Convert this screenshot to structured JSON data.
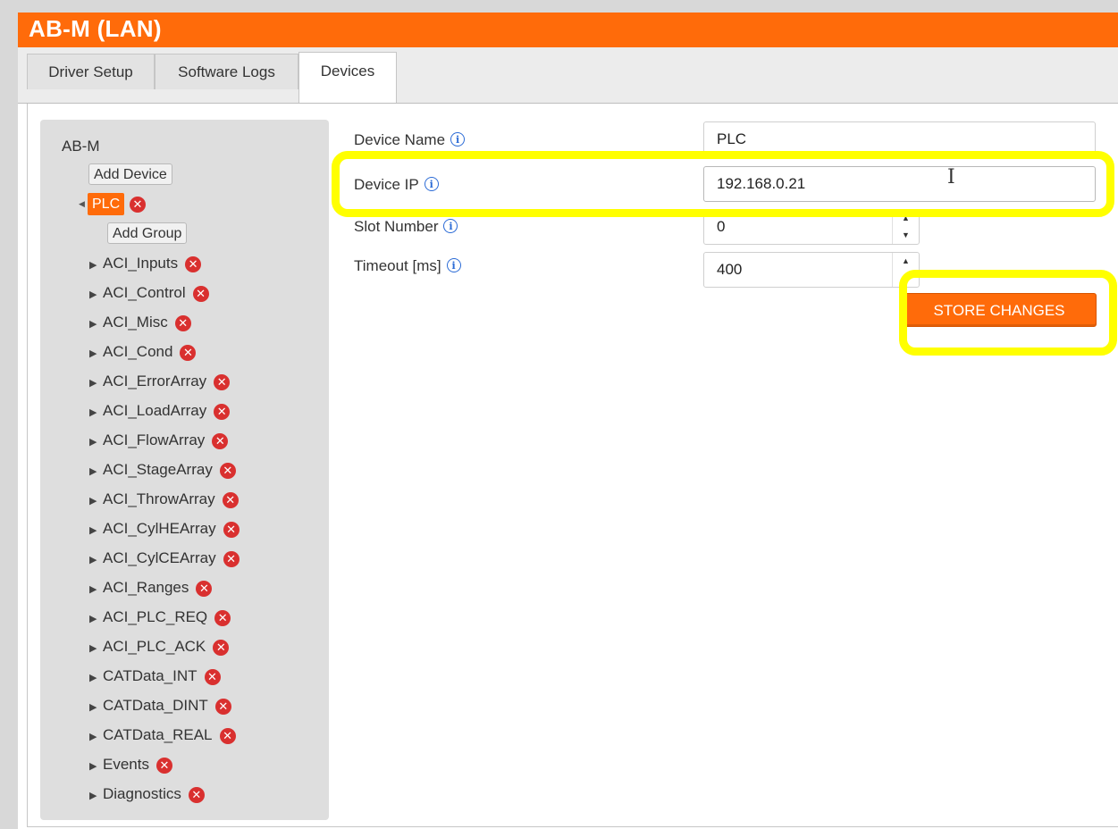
{
  "app": {
    "title": "AB-M (LAN)"
  },
  "tabs": [
    {
      "label": "Driver Setup"
    },
    {
      "label": "Software Logs"
    },
    {
      "label": "Devices"
    }
  ],
  "tree": {
    "root": "AB-M",
    "add_device": "Add Device",
    "device": "PLC",
    "add_group": "Add Group",
    "groups": [
      "ACI_Inputs",
      "ACI_Control",
      "ACI_Misc",
      "ACI_Cond",
      "ACI_ErrorArray",
      "ACI_LoadArray",
      "ACI_FlowArray",
      "ACI_StageArray",
      "ACI_ThrowArray",
      "ACI_CylHEArray",
      "ACI_CylCEArray",
      "ACI_Ranges",
      "ACI_PLC_REQ",
      "ACI_PLC_ACK",
      "CATData_INT",
      "CATData_DINT",
      "CATData_REAL",
      "Events",
      "Diagnostics"
    ]
  },
  "form": {
    "device_name": {
      "label": "Device Name",
      "value": "PLC"
    },
    "device_ip": {
      "label": "Device IP",
      "value": "192.168.0.21"
    },
    "slot_number": {
      "label": "Slot Number",
      "value": "0"
    },
    "timeout": {
      "label": "Timeout [ms]",
      "value": "400"
    },
    "store_button": "STORE CHANGES"
  },
  "icons": {
    "info": "info-icon",
    "delete": "delete-icon",
    "expand": "expand-arrow-icon"
  },
  "colors": {
    "accent": "#ff6b0a",
    "highlight": "#ffff00",
    "delete": "#d9302f",
    "info": "#2b6bd6"
  }
}
